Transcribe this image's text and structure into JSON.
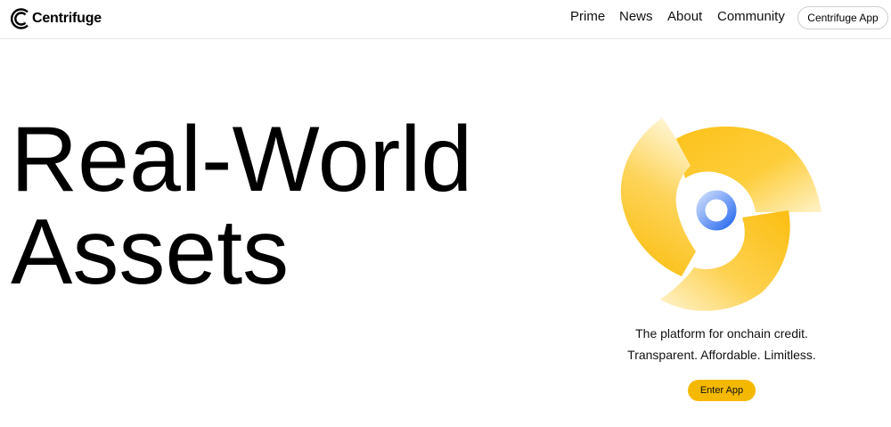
{
  "header": {
    "logo_text": "Centrifuge",
    "nav": [
      "Prime",
      "News",
      "About",
      "Community"
    ],
    "app_button": "Centrifuge App"
  },
  "hero": {
    "title_line1": "Real-World",
    "title_line2": "Assets",
    "tagline_line1": "The platform for onchain credit.",
    "tagline_line2": "Transparent. Affordable. Limitless.",
    "cta_label": "Enter App"
  },
  "colors": {
    "accent_yellow": "#f5b800",
    "center_blue": "#3e7bf0",
    "border": "#e6e6e6"
  }
}
